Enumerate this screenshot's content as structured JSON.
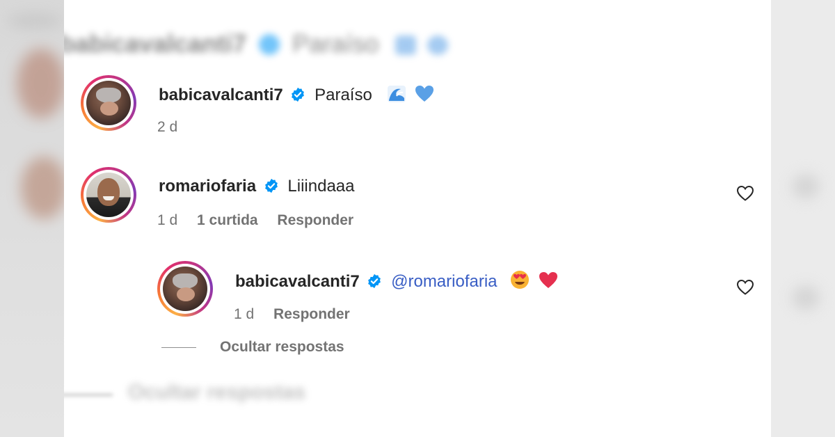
{
  "background_ghost": {
    "top_text": "babicavalcanti7",
    "top_comment": "Paraíso",
    "bottom_text": "Ocultar respostas"
  },
  "comments": [
    {
      "username": "babicavalcanti7",
      "verified": true,
      "text": "Paraíso",
      "emojis": [
        "wave-icon",
        "blue-heart-icon"
      ],
      "time": "2 d"
    },
    {
      "username": "romariofaria",
      "verified": true,
      "text": "Liiindaaa",
      "time": "1 d",
      "likes": "1 curtida",
      "reply_label": "Responder"
    }
  ],
  "reply": {
    "username": "babicavalcanti7",
    "verified": true,
    "mention": "@romariofaria",
    "emojis": [
      "heart-eyes-icon",
      "red-heart-icon"
    ],
    "time": "1 d",
    "reply_label": "Responder"
  },
  "hide_replies_label": "Ocultar respostas",
  "colors": {
    "verified": "#0095f6",
    "mention": "#385dc4",
    "meta": "#737373",
    "text": "#262626"
  }
}
